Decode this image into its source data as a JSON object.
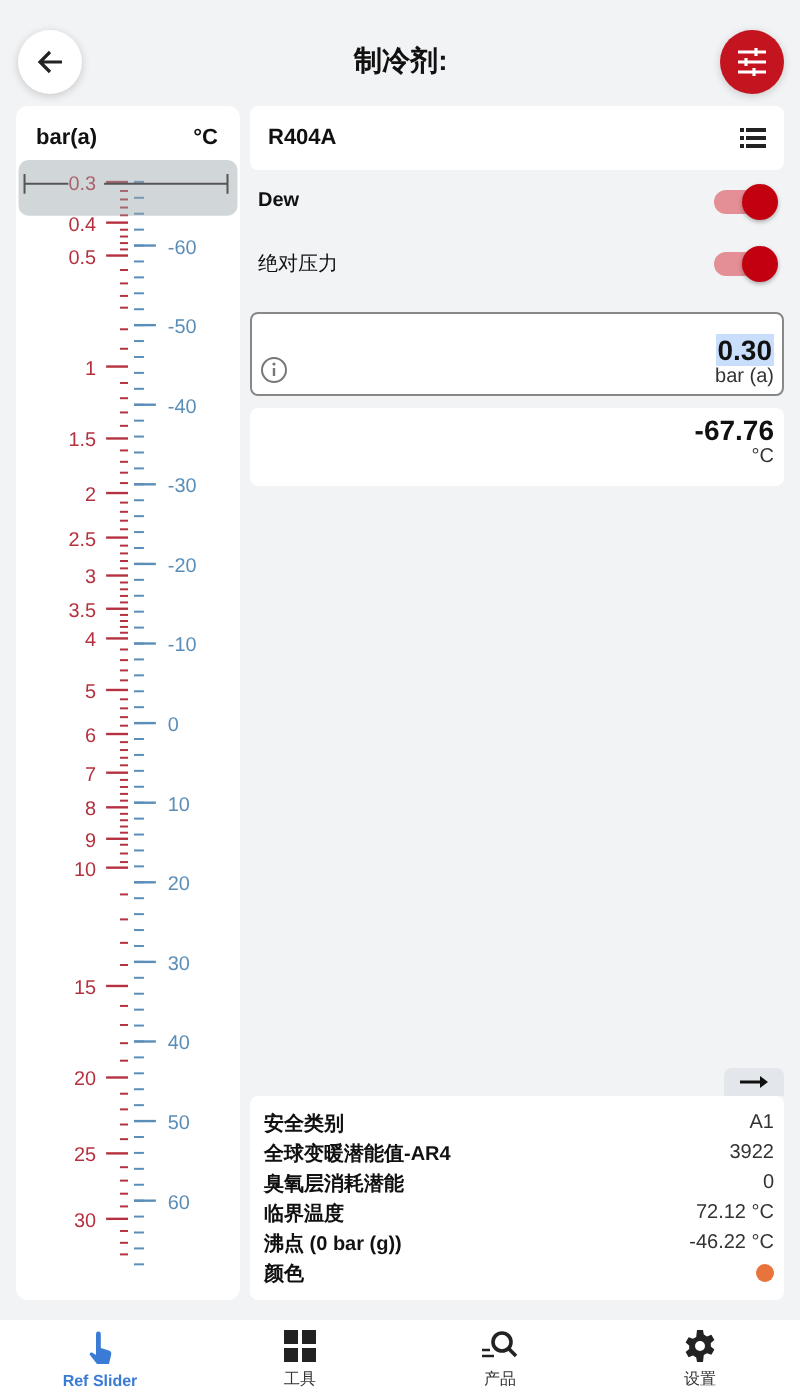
{
  "header": {
    "title": "制冷剂:"
  },
  "scale": {
    "pressure_unit": "bar(a)",
    "temperature_unit": "°C",
    "slider": {
      "level": 0
    },
    "pressure_labels": [
      "0.3",
      "0.4",
      "0.5",
      "1",
      "1.5",
      "2",
      "2.5",
      "3",
      "3.5",
      "4",
      "5",
      "6",
      "7",
      "8",
      "9",
      "10",
      "15",
      "20",
      "25",
      "30"
    ],
    "temperature_labels": [
      "-60",
      "-50",
      "-40",
      "-30",
      "-20",
      "-10",
      "0",
      "10",
      "20",
      "30",
      "40",
      "50",
      "60"
    ]
  },
  "refrigerant": {
    "name": "R404A"
  },
  "toggles": [
    {
      "label": "Dew",
      "on": true,
      "bold": true
    },
    {
      "label": "绝对压力",
      "on": true,
      "bold": false
    }
  ],
  "pressure_input": {
    "value": "0.30",
    "unit": "bar (a)",
    "selected": true
  },
  "temperature_output": {
    "value": "-67.76",
    "unit": "°C"
  },
  "properties": [
    {
      "label": "安全类别",
      "value": "A1"
    },
    {
      "label": "全球变暖潜能值-AR4",
      "value": "3922"
    },
    {
      "label": "臭氧层消耗潜能",
      "value": "0"
    },
    {
      "label": "临界温度",
      "value": "72.12 °C"
    },
    {
      "label": "沸点 (0 bar (g))",
      "value": "-46.22 °C"
    },
    {
      "label": "颜色",
      "color": "#e8743b"
    }
  ],
  "nav": [
    {
      "label": "Ref Slider",
      "kind": "hand",
      "selected": true
    },
    {
      "label": "工具",
      "kind": "grid",
      "selected": false
    },
    {
      "label": "产品",
      "kind": "search",
      "selected": false
    },
    {
      "label": "设置",
      "kind": "gear",
      "selected": false
    }
  ]
}
